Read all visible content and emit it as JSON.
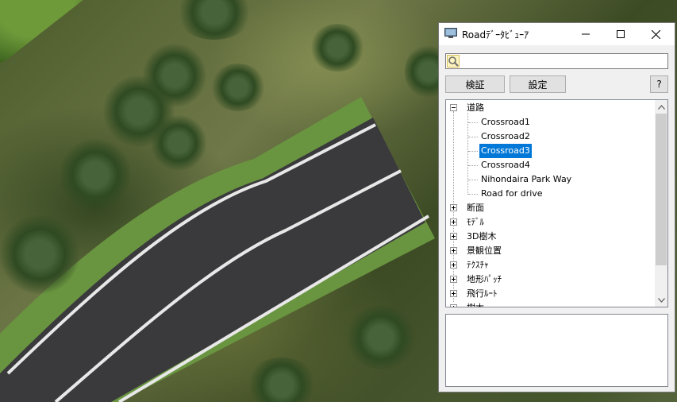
{
  "window": {
    "title": "Roadﾃﾞｰﾀﾋﾞｭｰｱ",
    "icon": "monitor-app-icon"
  },
  "search": {
    "value": "",
    "placeholder": "",
    "icon": "search-icon"
  },
  "buttons": {
    "verify": "検証",
    "settings": "設定",
    "help": "?"
  },
  "tree": {
    "roads_label": "道路",
    "roads": [
      "Crossroad1",
      "Crossroad2",
      "Crossroad3",
      "Crossroad4",
      "Nihondaira Park Way",
      "Road for drive"
    ],
    "selected_index": 2,
    "categories": [
      "断面",
      "ﾓﾃﾞﾙ",
      "3D樹木",
      "景観位置",
      "ﾃｸｽﾁｬ",
      "地形ﾊﾟｯﾁ",
      "飛行ﾙｰﾄ",
      "樹木"
    ]
  },
  "colors": {
    "selection": "#0078d7",
    "road": "#3b3b3e",
    "grass": "#6f9a40"
  }
}
